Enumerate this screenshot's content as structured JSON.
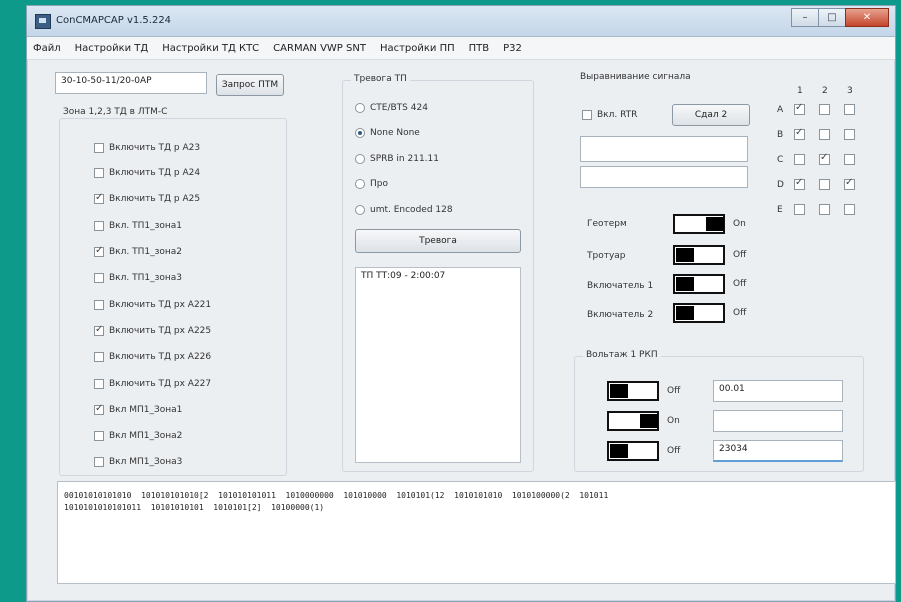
{
  "window": {
    "title": "ConCMAPCAP v1.5.224",
    "min": "–",
    "max": "□",
    "close": "✕"
  },
  "menu": [
    "Файл",
    "Настройки ТД",
    "Настройки ТД КТС",
    "CARMAN VWP SNT",
    "Настройки ПП",
    "ПТВ",
    "Р32"
  ],
  "left": {
    "date_value": "30-10-50-11/20-0AP",
    "date_button": "Запрос ПТМ",
    "group_title": "Зона 1,2,3 ТД в ЛТМ-С",
    "items": [
      {
        "label": "Включить ТД р A23",
        "checked": false
      },
      {
        "label": "Включить ТД р A24",
        "checked": false
      },
      {
        "label": "Включить ТД р A25",
        "checked": true
      },
      {
        "label": "Вкл. ТП1_зона1",
        "checked": false
      },
      {
        "label": "Вкл. ТП1_зона2",
        "checked": true
      },
      {
        "label": "Вкл. ТП1_зона3",
        "checked": false
      },
      {
        "label": "Включить ТД рх A221",
        "checked": false
      },
      {
        "label": "Включить ТД рх A225",
        "checked": true
      },
      {
        "label": "Включить ТД рх A226",
        "checked": false
      },
      {
        "label": "Включить ТД рх A227",
        "checked": false
      },
      {
        "label": "Вкл МП1_Зона1",
        "checked": true
      },
      {
        "label": "Вкл МП1_Зона2",
        "checked": false
      },
      {
        "label": "Вкл МП1_Зона3",
        "checked": false
      }
    ]
  },
  "middle": {
    "group_title": "Тревога ТП",
    "radios": [
      {
        "label": "CTE/BTS 424",
        "checked": false
      },
      {
        "label": "None None",
        "checked": true
      },
      {
        "label": "SPRB in 211.11",
        "checked": false
      },
      {
        "label": "Про",
        "checked": false
      },
      {
        "label": "umt. Encoded 128",
        "checked": false
      }
    ],
    "button": "Тревога",
    "list": [
      "ТП ТТ:09 - 2:00:07"
    ]
  },
  "right": {
    "signals_title": "Выравнивание сигнала",
    "enable_label": "Вкл. RTR",
    "send_button": "Сдал 2",
    "matrix_cols": [
      "1",
      "2",
      "3"
    ],
    "matrix_rows": [
      {
        "label": "A",
        "values": [
          true,
          false,
          false
        ]
      },
      {
        "label": "B",
        "values": [
          true,
          false,
          false
        ]
      },
      {
        "label": "C",
        "values": [
          false,
          true,
          false
        ]
      },
      {
        "label": "D",
        "values": [
          true,
          false,
          true
        ]
      },
      {
        "label": "E",
        "values": [
          false,
          false,
          false
        ]
      }
    ],
    "toggles": [
      {
        "label": "Геотерм",
        "state": "On",
        "value": 1
      },
      {
        "label": "Тротуар",
        "state": "Off",
        "value": 0
      },
      {
        "label": "Включатель 1",
        "state": "Off",
        "value": 0
      },
      {
        "label": "Включатель 2",
        "state": "Off",
        "value": 0
      }
    ],
    "bottom_group_title": "Вольтаж 1 РКП",
    "bottom_rows": [
      {
        "state": "Off",
        "value": 0,
        "text": "00.01"
      },
      {
        "state": "On",
        "value": 1,
        "text": ""
      },
      {
        "state": "Off",
        "value": 0,
        "text": "23034"
      }
    ]
  },
  "log": {
    "lines": [
      "00101010101010  101010101010[2  101010101011  1010000000  101010000  1010101(12  1010101010  1010100000(2  101011",
      "1010101010101011  10101010101  1010101[2]  10100000(1)"
    ]
  }
}
